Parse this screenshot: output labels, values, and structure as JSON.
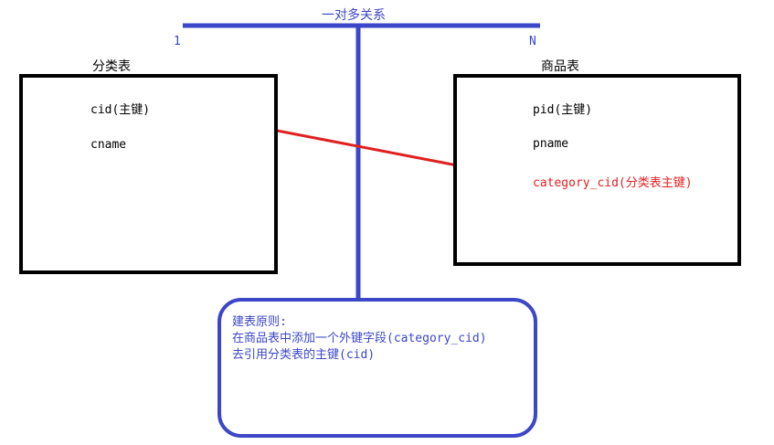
{
  "relation": {
    "title": "一对多关系",
    "left_cardinality": "1",
    "right_cardinality": "N"
  },
  "category_table": {
    "name": "分类表",
    "fields": [
      "cid(主键)",
      "cname"
    ]
  },
  "product_table": {
    "name": "商品表",
    "fields": [
      "pid(主键)",
      "pname"
    ],
    "foreign_key": "category_cid(分类表主键)"
  },
  "note": {
    "lines": [
      "建表原则:",
      "在商品表中添加一个外键字段(category_cid)",
      "去引用分类表的主键(cid)"
    ]
  },
  "colors": {
    "relation_line": "#3c46c8",
    "foreign_key_arrow": "#e02020",
    "table_border": "#000000"
  }
}
